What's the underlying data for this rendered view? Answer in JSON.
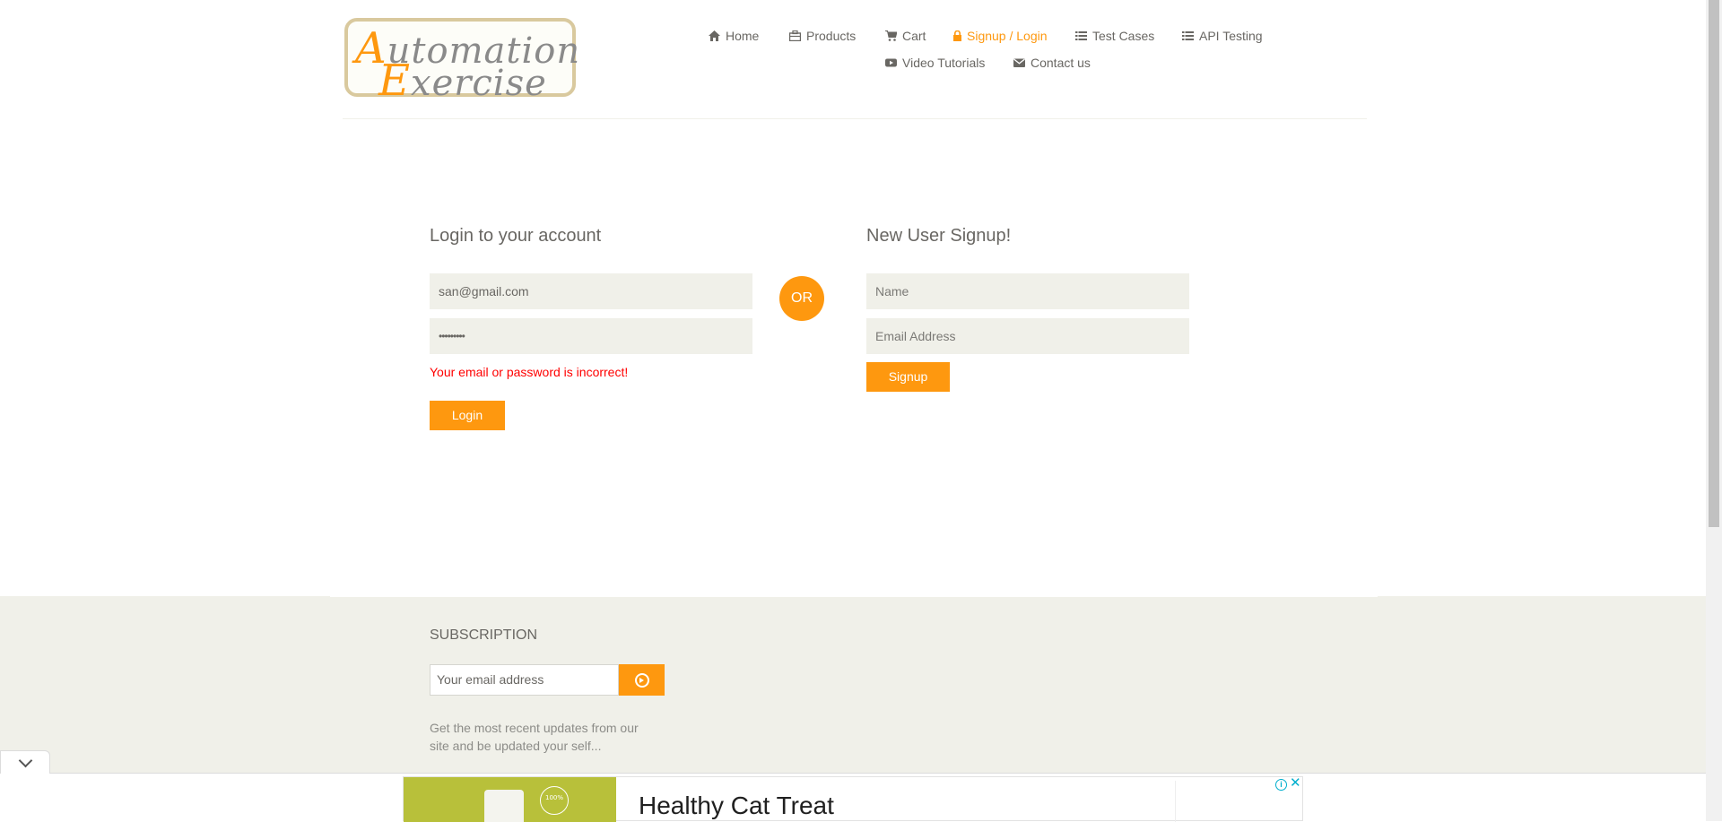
{
  "header": {
    "logo": {
      "line1_initial": "A",
      "line1_rest": "utomation",
      "line2_initial": "E",
      "line2_rest": "xercise"
    },
    "nav": [
      {
        "label": "Home",
        "icon": "home-icon"
      },
      {
        "label": "Products",
        "icon": "products-icon"
      },
      {
        "label": "Cart",
        "icon": "cart-icon"
      },
      {
        "label": "Signup / Login",
        "icon": "lock-icon",
        "active": true
      },
      {
        "label": "Test Cases",
        "icon": "list-icon"
      },
      {
        "label": "API Testing",
        "icon": "list-icon"
      },
      {
        "label": "Video Tutorials",
        "icon": "youtube-icon"
      },
      {
        "label": "Contact us",
        "icon": "envelope-icon"
      }
    ]
  },
  "login": {
    "title": "Login to your account",
    "email_value": "san@gmail.com",
    "password_value": "•••••••••",
    "error": "Your email or password is incorrect!",
    "button": "Login"
  },
  "or_label": "OR",
  "signup": {
    "title": "New User Signup!",
    "name_placeholder": "Name",
    "email_placeholder": "Email Address",
    "button": "Signup"
  },
  "footer": {
    "subscription_title": "SUBSCRIPTION",
    "email_placeholder": "Your email address",
    "description": "Get the most recent updates from our site and be updated your self..."
  },
  "ad": {
    "title": "Healthy Cat Treat",
    "badge_text": "100% Natural"
  },
  "colors": {
    "accent": "#fe980f",
    "error": "#ff0000",
    "field_bg": "#f0f0e9",
    "text": "#696763"
  }
}
